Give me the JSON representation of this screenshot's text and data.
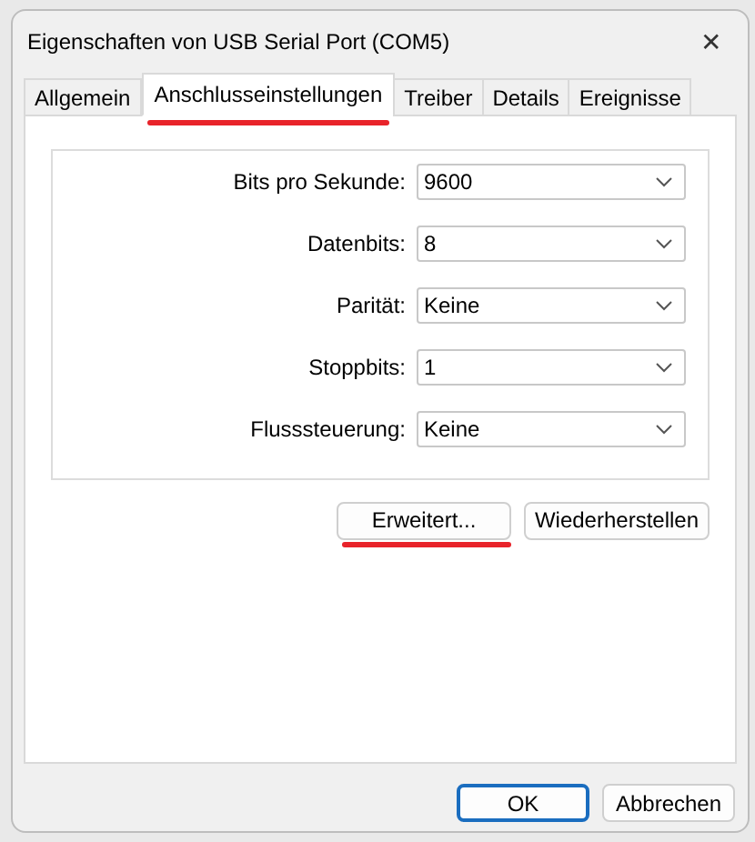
{
  "window": {
    "title": "Eigenschaften von USB Serial Port (COM5)",
    "close": "✕"
  },
  "tabs": [
    {
      "label": "Allgemein",
      "selected": false,
      "highlighted": false
    },
    {
      "label": "Anschlusseinstellungen",
      "selected": true,
      "highlighted": true
    },
    {
      "label": "Treiber",
      "selected": false,
      "highlighted": false
    },
    {
      "label": "Details",
      "selected": false,
      "highlighted": false
    },
    {
      "label": "Ereignisse",
      "selected": false,
      "highlighted": false
    }
  ],
  "settings": [
    {
      "label": "Bits pro Sekunde:",
      "value": "9600"
    },
    {
      "label": "Datenbits:",
      "value": "8"
    },
    {
      "label": "Parität:",
      "value": "Keine"
    },
    {
      "label": "Stoppbits:",
      "value": "1"
    },
    {
      "label": "Flusssteuerung:",
      "value": "Keine"
    }
  ],
  "panel_buttons": [
    {
      "label": "Erweitert...",
      "highlighted": true
    },
    {
      "label": "Wiederherstellen",
      "highlighted": false
    }
  ],
  "dialog_buttons": [
    {
      "label": "OK",
      "default": true
    },
    {
      "label": "Abbrechen",
      "default": false
    }
  ]
}
